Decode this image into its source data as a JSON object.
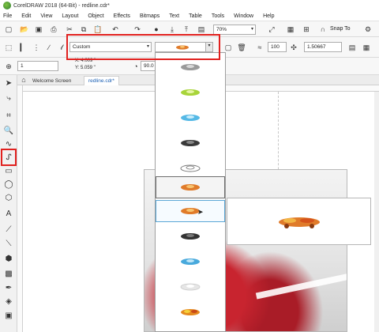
{
  "window": {
    "title": "CorelDRAW 2018 (64-Bit) - redline.cdr*"
  },
  "menu": [
    "File",
    "Edit",
    "View",
    "Layout",
    "Object",
    "Effects",
    "Bitmaps",
    "Text",
    "Table",
    "Tools",
    "Window",
    "Help"
  ],
  "toolbar": {
    "zoom": "70%",
    "snap_to": "Snap To"
  },
  "property_bar": {
    "preset": "Custom",
    "spacing": "100",
    "scale": "1.50667",
    "x": "X: 4.009 \"",
    "y": "Y: 5.059 \"",
    "count": "1",
    "angle": "90.0"
  },
  "tabs": [
    "Welcome Screen",
    "redline.cdr*"
  ],
  "dropdown": {
    "items": [
      {
        "icon": "car-gray-brush-icon",
        "color": "#9a9a9a"
      },
      {
        "icon": "car-lime-brush-icon",
        "color": "#a8d43a"
      },
      {
        "icon": "car-cyan-brush-icon",
        "color": "#55b9e6"
      },
      {
        "icon": "car-black-brush-icon",
        "color": "#3a3a3a"
      },
      {
        "icon": "car-outline-brush-icon",
        "color": "#7a7a7a"
      },
      {
        "icon": "car-orange-brush-icon",
        "color": "#e07b2a"
      },
      {
        "icon": "car-orange-brush-icon",
        "color": "#e07b2a"
      },
      {
        "icon": "car-black-brush-icon",
        "color": "#333333"
      },
      {
        "icon": "car-cyan-brush-icon",
        "color": "#48a9dc"
      },
      {
        "icon": "car-white-brush-icon",
        "color": "#c9c9c9"
      },
      {
        "icon": "car-flame-brush-icon",
        "color": "#e58a1f"
      }
    ]
  },
  "colors": {
    "highlight": "#e1211f",
    "accent": "#5aa7d6"
  }
}
